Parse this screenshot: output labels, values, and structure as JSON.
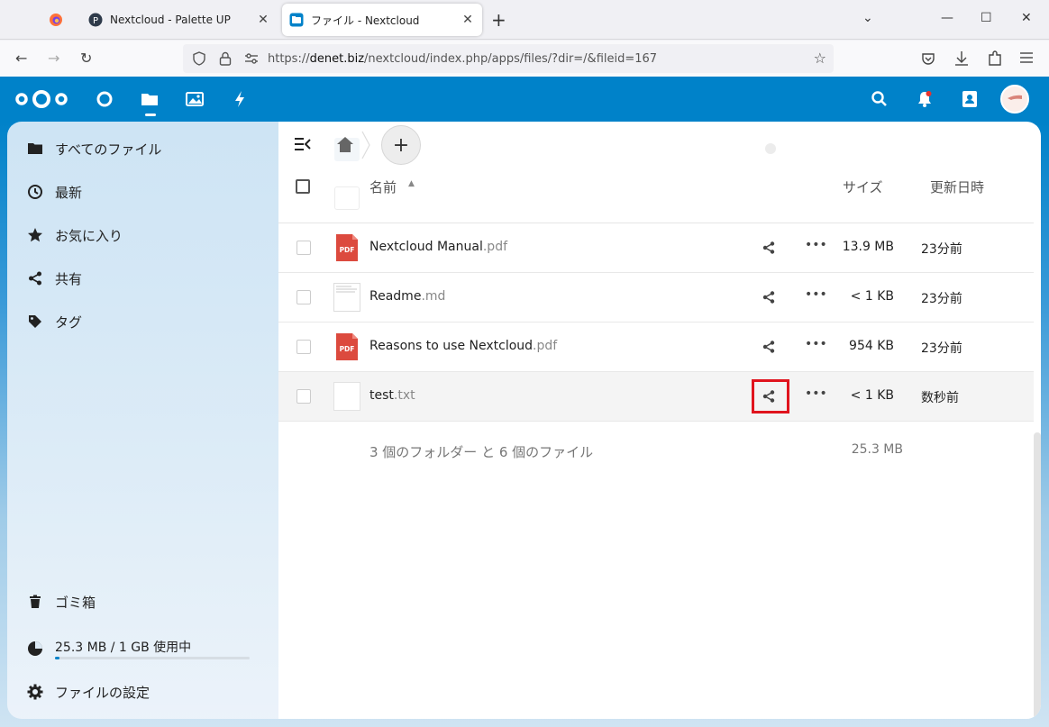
{
  "browser": {
    "tabs": [
      {
        "title": "Nextcloud - Palette UP"
      },
      {
        "title": "ファイル - Nextcloud"
      }
    ],
    "url_prefix": "https://",
    "url_domain": "denet.biz",
    "url_path": "/nextcloud/index.php/apps/files/?dir=/&fileid=167"
  },
  "header": {
    "apps": [
      "dashboard-icon",
      "files-icon",
      "photos-icon",
      "activity-icon"
    ],
    "icons": [
      "search-icon",
      "notifications-icon",
      "contacts-icon"
    ]
  },
  "sidebar": {
    "items": [
      {
        "label": "すべてのファイル",
        "icon": "folder-icon"
      },
      {
        "label": "最新",
        "icon": "clock-icon"
      },
      {
        "label": "お気に入り",
        "icon": "star-icon"
      },
      {
        "label": "共有",
        "icon": "share-icon"
      },
      {
        "label": "タグ",
        "icon": "tag-icon"
      }
    ],
    "trash": "ゴミ箱",
    "quota": "25.3 MB / 1 GB 使用中",
    "quota_fraction": 0.025,
    "settings": "ファイルの設定"
  },
  "table": {
    "col_name": "名前",
    "col_size": "サイズ",
    "col_modified": "更新日時",
    "rows": [
      {
        "base": "Nextcloud Manual",
        "ext": ".pdf",
        "type": "pdf",
        "size": "13.9 MB",
        "date": "23分前"
      },
      {
        "base": "Readme",
        "ext": ".md",
        "type": "md",
        "size": "< 1 KB",
        "date": "23分前"
      },
      {
        "base": "Reasons to use Nextcloud",
        "ext": ".pdf",
        "type": "pdf",
        "size": "954 KB",
        "date": "23分前"
      },
      {
        "base": "test",
        "ext": ".txt",
        "type": "txt",
        "size": "< 1 KB",
        "date": "数秒前"
      }
    ],
    "summary": "3 個のフォルダー と 6 個のファイル",
    "summary_size": "25.3 MB"
  },
  "colors": {
    "brand": "#0082c9",
    "highlight": "#e0141e",
    "pdf": "#dc4a3e"
  }
}
